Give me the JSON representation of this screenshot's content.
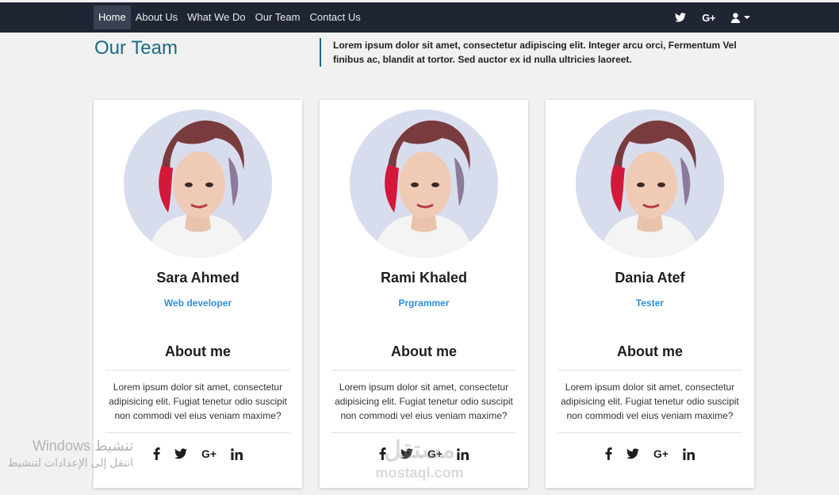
{
  "nav": {
    "items": [
      "Home",
      "About Us",
      "What We Do",
      "Our Team",
      "Contact Us"
    ],
    "active_index": 0,
    "icons": [
      "twitter-icon",
      "google-plus-icon",
      "user-icon"
    ],
    "google_plus_label": "G+"
  },
  "header": {
    "title": "Our Team",
    "intro": "Lorem ipsum dolor sit amet, consectetur adipiscing elit. Integer arcu orci, Fermentum Vel finibus ac, blandit at tortor. Sed auctor ex id nulla ultricies laoreet."
  },
  "cards": [
    {
      "name": "Sara Ahmed",
      "role": "Web developer",
      "about_title": "About me",
      "description": "Lorem ipsum dolor sit amet, consectetur adipisicing elit. Fugiat tenetur odio suscipit non commodi vel eius veniam maxime?",
      "google_plus_label": "G+"
    },
    {
      "name": "Rami Khaled",
      "role": "Prgrammer",
      "about_title": "About me",
      "description": "Lorem ipsum dolor sit amet, consectetur adipisicing elit. Fugiat tenetur odio suscipit non commodi vel eius veniam maxime?",
      "google_plus_label": "G+"
    },
    {
      "name": "Dania Atef",
      "role": "Tester",
      "about_title": "About me",
      "description": "Lorem ipsum dolor sit amet, consectetur adipisicing elit. Fugiat tenetur odio suscipit non commodi vel eius veniam maxime?",
      "google_plus_label": "G+"
    }
  ],
  "social_icons": [
    "facebook-icon",
    "twitter-icon",
    "google-plus-icon",
    "linkedin-icon"
  ],
  "watermarks": {
    "windows_line1": "Windows تنشيط",
    "windows_line2": "انتقل إلى الإعدادات لتنشيط",
    "site_arabic": "مستقل",
    "site_url": "mostaql.com"
  },
  "colors": {
    "navbar_bg": "#1f2533",
    "page_bg": "#f1f1f1",
    "title_accent": "#1b6c80",
    "role_text": "#2f8fd6"
  }
}
